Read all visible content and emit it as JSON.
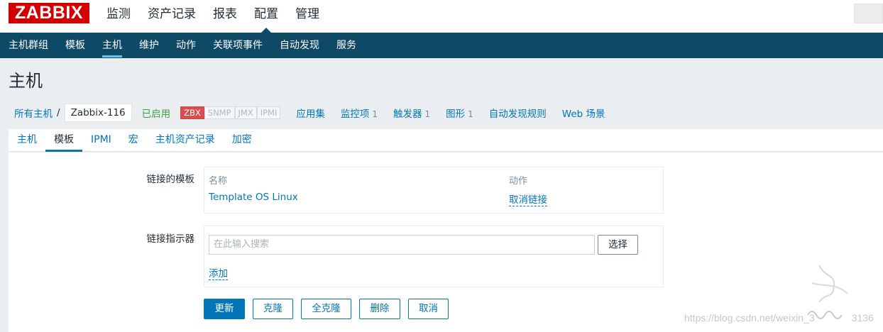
{
  "brand": {
    "logo_text": "ZABBIX"
  },
  "top_nav": [
    {
      "label": "监测"
    },
    {
      "label": "资产记录"
    },
    {
      "label": "报表"
    },
    {
      "label": "配置"
    },
    {
      "label": "管理"
    }
  ],
  "sub_nav": [
    {
      "label": "主机群组"
    },
    {
      "label": "模板"
    },
    {
      "label": "主机"
    },
    {
      "label": "维护"
    },
    {
      "label": "动作"
    },
    {
      "label": "关联项事件"
    },
    {
      "label": "自动发现"
    },
    {
      "label": "服务"
    }
  ],
  "page_title": "主机",
  "breadcrumb": {
    "all_hosts": "所有主机",
    "separator": "/",
    "current_host": "Zabbix-116",
    "status": "已启用",
    "availability": [
      "ZBX",
      "SNMP",
      "JMX",
      "IPMI"
    ],
    "links": [
      {
        "label": "应用集",
        "count": ""
      },
      {
        "label": "监控项",
        "count": "1"
      },
      {
        "label": "触发器",
        "count": "1"
      },
      {
        "label": "图形",
        "count": "1"
      },
      {
        "label": "自动发现规则",
        "count": ""
      },
      {
        "label": "Web 场景",
        "count": ""
      }
    ]
  },
  "tabs": [
    {
      "label": "主机"
    },
    {
      "label": "模板"
    },
    {
      "label": "IPMI"
    },
    {
      "label": "宏"
    },
    {
      "label": "主机资产记录"
    },
    {
      "label": "加密"
    }
  ],
  "linked_templates": {
    "label": "链接的模板",
    "col_name": "名称",
    "col_action": "动作",
    "template_name": "Template OS Linux",
    "unlink_label": "取消链接"
  },
  "link_indicator": {
    "label": "链接指示器",
    "search_placeholder": "在此输入搜索",
    "select_label": "选择",
    "add_label": "添加"
  },
  "actions": {
    "update": "更新",
    "clone": "克隆",
    "full_clone": "全克隆",
    "delete": "删除",
    "cancel": "取消"
  },
  "watermark": "https://blog.csdn.net/weixin_3",
  "watermark_tail": "3136",
  "colors": {
    "brand_red": "#d40000",
    "nav_bg": "#0e4966",
    "link_blue": "#0275b8",
    "status_green": "#429e47"
  }
}
